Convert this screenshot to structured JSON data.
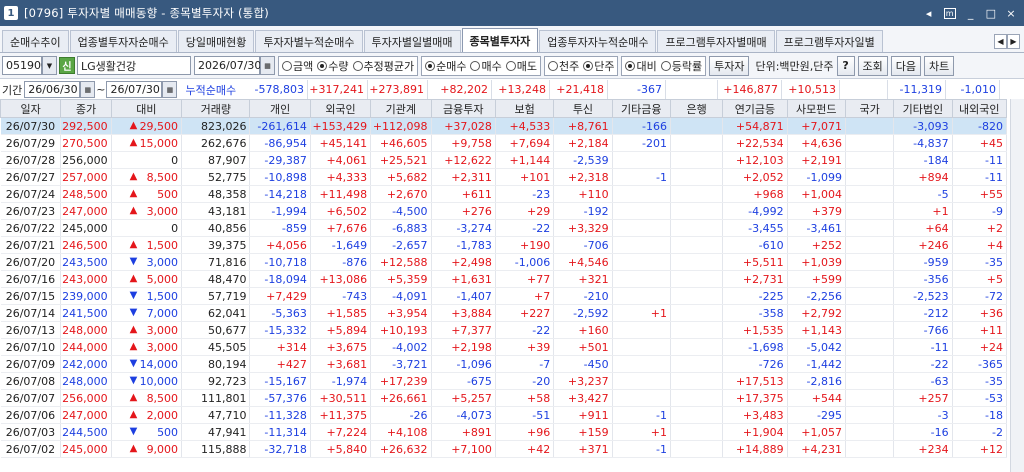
{
  "window": {
    "code": "1",
    "title": "[0796] 투자자별 매매동향 - 종목별투자자 (통합)",
    "ctrl_back": "◂",
    "ctrl_m": "m",
    "ctrl_min": "_",
    "ctrl_max": "□",
    "ctrl_close": "×"
  },
  "tabs": [
    {
      "label": "순매수추이"
    },
    {
      "label": "업종별투자자순매수"
    },
    {
      "label": "당일매매현황"
    },
    {
      "label": "투자자별누적순매수"
    },
    {
      "label": "투자자별일별매매"
    },
    {
      "label": "종목별투자자"
    },
    {
      "label": "업종투자자누적순매수"
    },
    {
      "label": "프로그램투자자별매매"
    },
    {
      "label": "프로그램투자자일별"
    }
  ],
  "active_tab": "종목별투자자",
  "toolbar": {
    "stock_code": "051900",
    "shin_label": "신",
    "stock_name": "LG생활건강",
    "date": "2026/07/30",
    "radio_group1": [
      {
        "label": "금액",
        "on": false
      },
      {
        "label": "수량",
        "on": true
      },
      {
        "label": "추정평균가",
        "on": false
      }
    ],
    "radio_group2": [
      {
        "label": "순매수",
        "on": true
      },
      {
        "label": "매수",
        "on": false
      },
      {
        "label": "매도",
        "on": false
      }
    ],
    "radio_group3": [
      {
        "label": "천주",
        "on": false
      },
      {
        "label": "단주",
        "on": true
      }
    ],
    "radio_group4": [
      {
        "label": "대비",
        "on": true
      },
      {
        "label": "등락률",
        "on": false
      }
    ],
    "investor_button": "투자자",
    "unit_text": "단위:백만원,단주",
    "help_button": "?",
    "query_button": "조회",
    "next_button": "다음",
    "chart_button": "차트"
  },
  "toolbar2": {
    "period_label": "기간",
    "from": "26/06/30",
    "tilde": "~",
    "to": "26/07/30",
    "cum_label": "누적순매수",
    "sums": [
      "-578,803",
      "+317,241",
      "+273,891",
      "+82,202",
      "+13,248",
      "+21,418",
      "-367",
      "",
      "+146,877",
      "+10,513",
      "",
      "-11,319",
      "-1,010"
    ]
  },
  "columns": [
    "일자",
    "종가",
    "대비",
    "거래량",
    "개인",
    "외국인",
    "기관계",
    "금융투자",
    "보험",
    "투신",
    "기타금융",
    "은행",
    "연기금등",
    "사모펀드",
    "국가",
    "기타법인",
    "내외국인"
  ],
  "rows": [
    {
      "date": "26/07/30",
      "close": "292,500",
      "dir": "up",
      "chg": "29,500",
      "vol": "823,026",
      "v": [
        "-261,614",
        "+153,429",
        "+112,098",
        "+37,028",
        "+4,533",
        "+8,761",
        "-166",
        "",
        "+54,871",
        "+7,071",
        "",
        "-3,093",
        "-820"
      ]
    },
    {
      "date": "26/07/29",
      "close": "270,500",
      "dir": "up",
      "chg": "15,000",
      "vol": "262,676",
      "v": [
        "-86,954",
        "+45,141",
        "+46,605",
        "+9,758",
        "+7,694",
        "+2,184",
        "-201",
        "",
        "+22,534",
        "+4,636",
        "",
        "-4,837",
        "+45"
      ]
    },
    {
      "date": "26/07/28",
      "close": "256,000",
      "dir": "none",
      "chg": "0",
      "vol": "87,907",
      "v": [
        "-29,387",
        "+4,061",
        "+25,521",
        "+12,622",
        "+1,144",
        "-2,539",
        "",
        "",
        "+12,103",
        "+2,191",
        "",
        "-184",
        "-11"
      ]
    },
    {
      "date": "26/07/27",
      "close": "257,000",
      "dir": "up",
      "chg": "8,500",
      "vol": "52,775",
      "v": [
        "-10,898",
        "+4,333",
        "+5,682",
        "+2,311",
        "+101",
        "+2,318",
        "-1",
        "",
        "+2,052",
        "-1,099",
        "",
        "+894",
        "-11"
      ]
    },
    {
      "date": "26/07/24",
      "close": "248,500",
      "dir": "up",
      "chg": "500",
      "vol": "48,358",
      "v": [
        "-14,218",
        "+11,498",
        "+2,670",
        "+611",
        "-23",
        "+110",
        "",
        "",
        "+968",
        "+1,004",
        "",
        "-5",
        "+55"
      ]
    },
    {
      "date": "26/07/23",
      "close": "247,000",
      "dir": "up",
      "chg": "3,000",
      "vol": "43,181",
      "v": [
        "-1,994",
        "+6,502",
        "-4,500",
        "+276",
        "+29",
        "-192",
        "",
        "",
        "-4,992",
        "+379",
        "",
        "+1",
        "-9"
      ]
    },
    {
      "date": "26/07/22",
      "close": "245,000",
      "dir": "none",
      "chg": "0",
      "vol": "40,856",
      "v": [
        "-859",
        "+7,676",
        "-6,883",
        "-3,274",
        "-22",
        "+3,329",
        "",
        "",
        "-3,455",
        "-3,461",
        "",
        "+64",
        "+2"
      ]
    },
    {
      "date": "26/07/21",
      "close": "246,500",
      "dir": "up",
      "chg": "1,500",
      "vol": "39,375",
      "v": [
        "+4,056",
        "-1,649",
        "-2,657",
        "-1,783",
        "+190",
        "-706",
        "",
        "",
        "-610",
        "+252",
        "",
        "+246",
        "+4"
      ]
    },
    {
      "date": "26/07/20",
      "close": "243,500",
      "dir": "down",
      "chg": "3,000",
      "vol": "71,816",
      "v": [
        "-10,718",
        "-876",
        "+12,588",
        "+2,498",
        "-1,006",
        "+4,546",
        "",
        "",
        "+5,511",
        "+1,039",
        "",
        "-959",
        "-35"
      ]
    },
    {
      "date": "26/07/16",
      "close": "243,000",
      "dir": "up",
      "chg": "5,000",
      "vol": "48,470",
      "v": [
        "-18,094",
        "+13,086",
        "+5,359",
        "+1,631",
        "+77",
        "+321",
        "",
        "",
        "+2,731",
        "+599",
        "",
        "-356",
        "+5"
      ]
    },
    {
      "date": "26/07/15",
      "close": "239,000",
      "dir": "down",
      "chg": "1,500",
      "vol": "57,719",
      "v": [
        "+7,429",
        "-743",
        "-4,091",
        "-1,407",
        "+7",
        "-210",
        "",
        "",
        "-225",
        "-2,256",
        "",
        "-2,523",
        "-72"
      ]
    },
    {
      "date": "26/07/14",
      "close": "241,500",
      "dir": "down",
      "chg": "7,000",
      "vol": "62,041",
      "v": [
        "-5,363",
        "+1,585",
        "+3,954",
        "+3,884",
        "+227",
        "-2,592",
        "+1",
        "",
        "-358",
        "+2,792",
        "",
        "-212",
        "+36"
      ]
    },
    {
      "date": "26/07/13",
      "close": "248,000",
      "dir": "up",
      "chg": "3,000",
      "vol": "50,677",
      "v": [
        "-15,332",
        "+5,894",
        "+10,193",
        "+7,377",
        "-22",
        "+160",
        "",
        "",
        "+1,535",
        "+1,143",
        "",
        "-766",
        "+11"
      ]
    },
    {
      "date": "26/07/10",
      "close": "244,000",
      "dir": "up",
      "chg": "3,000",
      "vol": "45,505",
      "v": [
        "+314",
        "+3,675",
        "-4,002",
        "+2,198",
        "+39",
        "+501",
        "",
        "",
        "-1,698",
        "-5,042",
        "",
        "-11",
        "+24"
      ]
    },
    {
      "date": "26/07/09",
      "close": "242,000",
      "dir": "down",
      "chg": "14,000",
      "vol": "80,194",
      "v": [
        "+427",
        "+3,681",
        "-3,721",
        "-1,096",
        "-7",
        "-450",
        "",
        "",
        "-726",
        "-1,442",
        "",
        "-22",
        "-365"
      ]
    },
    {
      "date": "26/07/08",
      "close": "248,000",
      "dir": "down",
      "chg": "10,000",
      "vol": "92,723",
      "v": [
        "-15,167",
        "-1,974",
        "+17,239",
        "-675",
        "-20",
        "+3,237",
        "",
        "",
        "+17,513",
        "-2,816",
        "",
        "-63",
        "-35"
      ]
    },
    {
      "date": "26/07/07",
      "close": "256,000",
      "dir": "up",
      "chg": "8,500",
      "vol": "111,801",
      "v": [
        "-57,376",
        "+30,511",
        "+26,661",
        "+5,257",
        "+58",
        "+3,427",
        "",
        "",
        "+17,375",
        "+544",
        "",
        "+257",
        "-53"
      ]
    },
    {
      "date": "26/07/06",
      "close": "247,000",
      "dir": "up",
      "chg": "2,000",
      "vol": "47,710",
      "v": [
        "-11,328",
        "+11,375",
        "-26",
        "-4,073",
        "-51",
        "+911",
        "-1",
        "",
        "+3,483",
        "-295",
        "",
        "-3",
        "-18"
      ]
    },
    {
      "date": "26/07/03",
      "close": "244,500",
      "dir": "down",
      "chg": "500",
      "vol": "47,941",
      "v": [
        "-11,314",
        "+7,224",
        "+4,108",
        "+891",
        "+96",
        "+159",
        "+1",
        "",
        "+1,904",
        "+1,057",
        "",
        "-16",
        "-2"
      ]
    },
    {
      "date": "26/07/02",
      "close": "245,000",
      "dir": "up",
      "chg": "9,000",
      "vol": "115,888",
      "v": [
        "-32,718",
        "+5,840",
        "+26,632",
        "+7,100",
        "+42",
        "+371",
        "-1",
        "",
        "+14,889",
        "+4,231",
        "",
        "+234",
        "+12"
      ]
    }
  ],
  "colors": {
    "up": "#e4161b",
    "down": "#1d3fe0",
    "selected_row": "#cfe4f5",
    "title_bar": "#38597f"
  }
}
